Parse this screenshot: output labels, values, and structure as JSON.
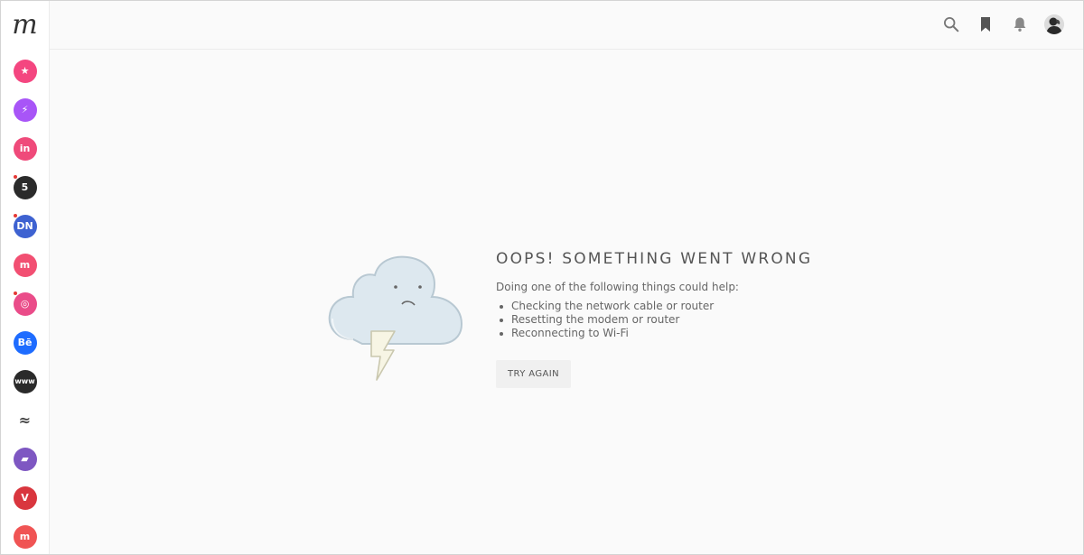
{
  "app": {
    "logo_letter": "m"
  },
  "sidebar": {
    "apps": [
      {
        "name": "product-hunt",
        "glyph": "★",
        "color": "#f44680",
        "badge": false
      },
      {
        "name": "bolt-app",
        "glyph": "⚡",
        "color": "#a855f7",
        "badge": false
      },
      {
        "name": "invision",
        "glyph": "in",
        "color": "#ef4a7a",
        "badge": false
      },
      {
        "name": "number-app",
        "glyph": "5",
        "color": "#2b2b2b",
        "badge": true
      },
      {
        "name": "designer-news",
        "glyph": "DN",
        "color": "#3e62d1",
        "badge": true
      },
      {
        "name": "muzli",
        "glyph": "m",
        "color": "#f24f72",
        "badge": false
      },
      {
        "name": "dribbble",
        "glyph": "◎",
        "color": "#ea4c89",
        "badge": true
      },
      {
        "name": "behance",
        "glyph": "Bē",
        "color": "#1e6cff",
        "badge": false
      },
      {
        "name": "www-app",
        "glyph": "www",
        "color": "#2a2a2a",
        "badge": false
      },
      {
        "name": "wave-app",
        "glyph": "≈",
        "color": "#ffffff",
        "badge": false
      },
      {
        "name": "ticket-app",
        "glyph": "▰",
        "color": "#7e57c2",
        "badge": false
      },
      {
        "name": "vivaldi-app",
        "glyph": "V",
        "color": "#d9363e",
        "badge": false
      },
      {
        "name": "muzli-script",
        "glyph": "m",
        "color": "#f05454",
        "badge": false
      }
    ]
  },
  "topbar": {
    "icons": [
      "search-icon",
      "bookmark-icon",
      "bell-icon",
      "avatar"
    ]
  },
  "error": {
    "title": "OOPS! SOMETHING WENT WRONG",
    "lead": "Doing one of the following things could help:",
    "tips": [
      "Checking the network cable or router",
      "Resetting the modem or router",
      "Reconnecting to Wi-Fi"
    ],
    "button_label": "TRY AGAIN"
  },
  "colors": {
    "page_bg": "#fafafa",
    "icon_gray": "#555555",
    "cloud_fill": "#dde8ef",
    "cloud_stroke": "#b8c8d2",
    "bolt_fill": "#f7f5e4"
  }
}
